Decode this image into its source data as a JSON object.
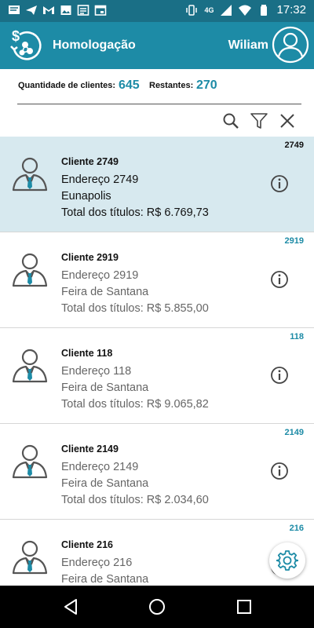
{
  "status_bar": {
    "time": "17:32",
    "network_label": "4G",
    "icons": [
      "message-icon",
      "telegram-icon",
      "gmail-icon",
      "gallery-icon",
      "news-icon",
      "calendar-icon",
      "vibrate-icon",
      "signal-icon",
      "wifi-icon",
      "battery-icon"
    ]
  },
  "header": {
    "title": "Homologação",
    "user_name": "Wiliam",
    "logo_symbol": "$"
  },
  "summary": {
    "total_label": "Quantidade de clientes:",
    "total_value": "645",
    "remaining_label": "Restantes:",
    "remaining_value": "270"
  },
  "toolbar": {
    "icons": [
      "search-icon",
      "filter-icon",
      "close-icon"
    ]
  },
  "clients": [
    {
      "code": "2749",
      "name": "Cliente 2749",
      "address": "Endereço 2749",
      "city": "Eunapolis",
      "total": "Total dos títulos: R$ 6.769,73",
      "selected": true
    },
    {
      "code": "2919",
      "name": "Cliente 2919",
      "address": "Endereço 2919",
      "city": "Feira de Santana",
      "total": "Total dos títulos: R$ 5.855,00",
      "selected": false
    },
    {
      "code": "118",
      "name": "Cliente 118",
      "address": "Endereço 118",
      "city": "Feira de Santana",
      "total": "Total dos títulos: R$ 9.065,82",
      "selected": false
    },
    {
      "code": "2149",
      "name": "Cliente 2149",
      "address": "Endereço 2149",
      "city": "Feira de Santana",
      "total": "Total dos títulos: R$ 2.034,60",
      "selected": false
    },
    {
      "code": "216",
      "name": "Cliente 216",
      "address": "Endereço 216",
      "city": "Feira de Santana",
      "total": "",
      "selected": false
    }
  ],
  "colors": {
    "primary": "#1d8ba6",
    "status_bar": "#1a6f86",
    "selected_row": "#d7e9ef",
    "accent_tie": "#1d8ba6"
  }
}
